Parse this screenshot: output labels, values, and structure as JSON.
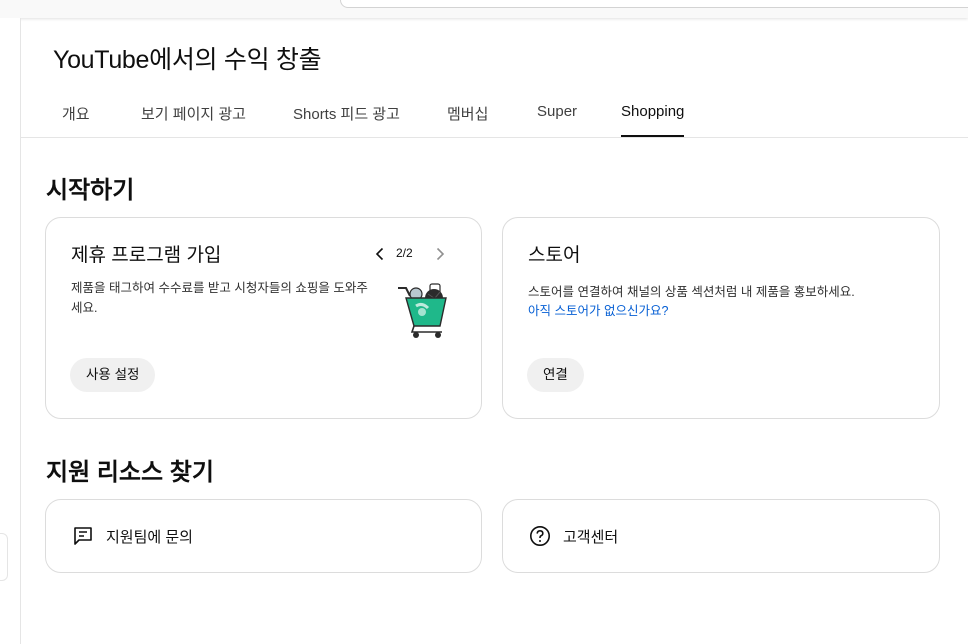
{
  "page": {
    "title": "YouTube에서의 수익 창출"
  },
  "tabs": [
    {
      "label": "개요",
      "active": false
    },
    {
      "label": "보기 페이지 광고",
      "active": false
    },
    {
      "label": "Shorts 피드 광고",
      "active": false
    },
    {
      "label": "멤버십",
      "active": false
    },
    {
      "label": "Super",
      "active": false
    },
    {
      "label": "Shopping",
      "active": true
    }
  ],
  "getting_started": {
    "heading": "시작하기",
    "affiliate_card": {
      "title": "제휴 프로그램 가입",
      "pager": "2/2",
      "description": "제품을 태그하여 수수료를 받고 시청자들의 쇼핑을 도와주세요.",
      "button": "사용 설정",
      "icon": "shopping-cart-illustration"
    },
    "store_card": {
      "title": "스토어",
      "description": "스토어를 연결하여 채널의 상품 섹션처럼 내 제품을 홍보하세요.",
      "link": "아직 스토어가 없으신가요?",
      "button": "연결"
    }
  },
  "resources": {
    "heading": "지원 리소스 찾기",
    "items": [
      {
        "label": "지원팀에 문의",
        "icon": "feedback-icon"
      },
      {
        "label": "고객센터",
        "icon": "help-circle-icon"
      }
    ]
  },
  "colors": {
    "link": "#065fd4",
    "accent_green": "#1fb88a",
    "pill_bg": "#f0f0f0",
    "border": "#dcdcdc"
  }
}
